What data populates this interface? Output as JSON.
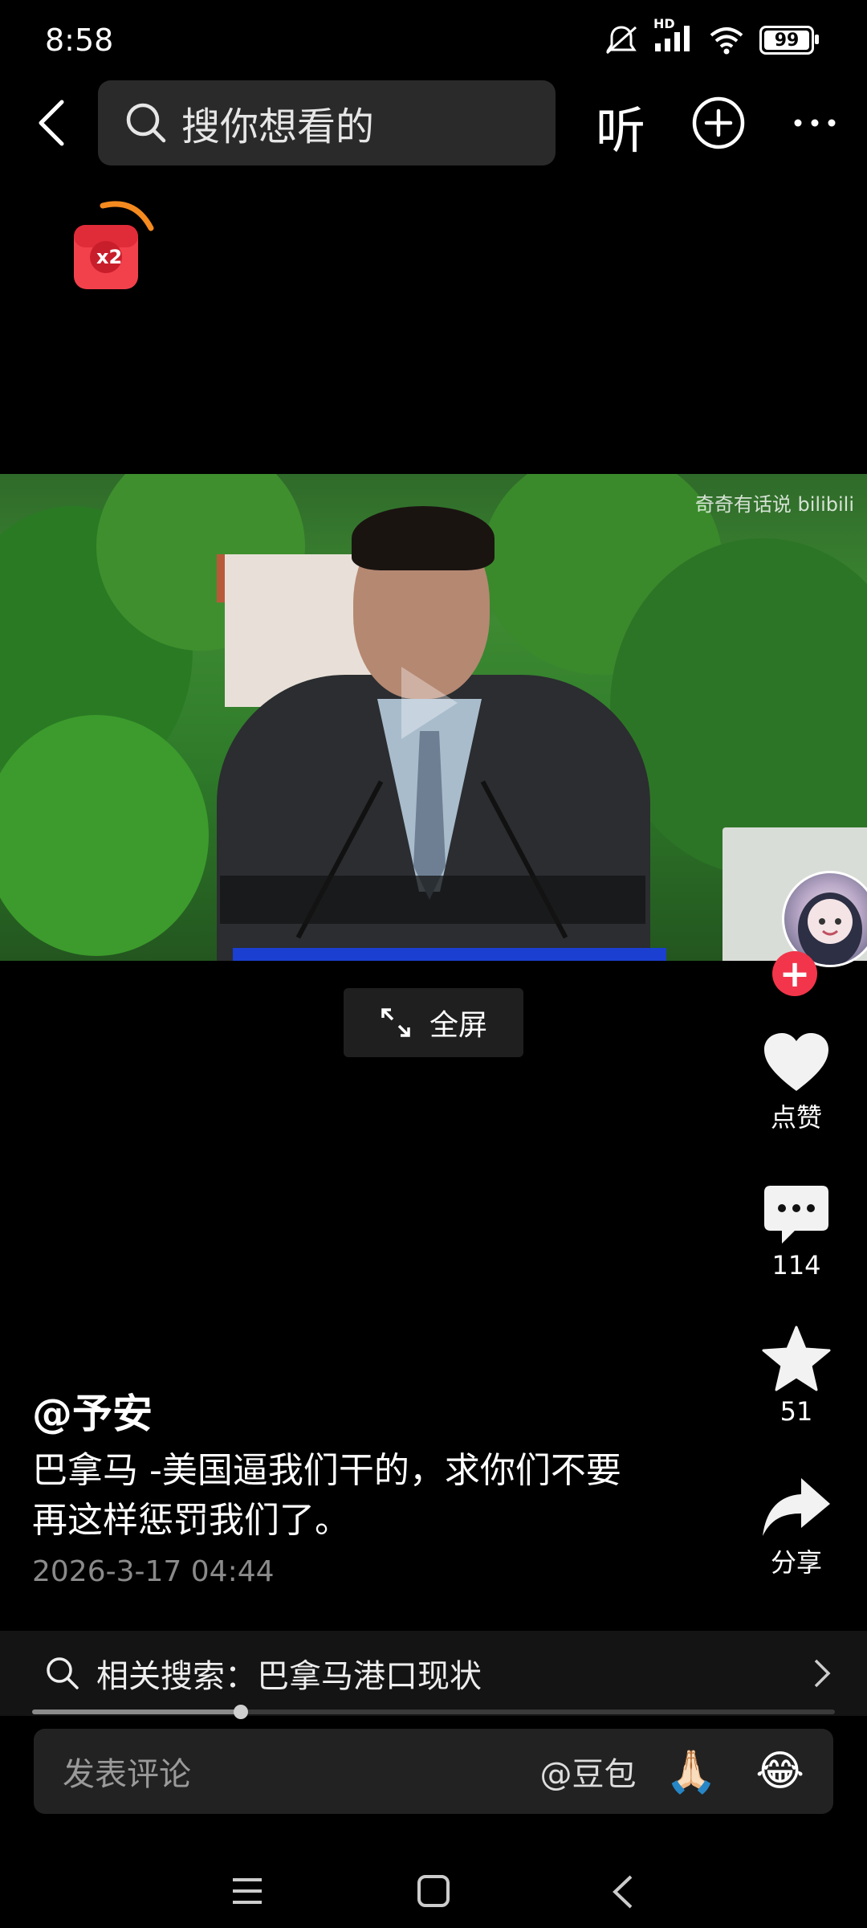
{
  "status": {
    "time": "8:58",
    "network": "HD",
    "battery": "99",
    "icons": [
      "mute-icon",
      "signal-icon",
      "wifi-icon",
      "battery-icon"
    ]
  },
  "topbar": {
    "search_placeholder": "搜你想看的",
    "listen_label": "听",
    "icons": [
      "back-icon",
      "search-icon",
      "add-icon",
      "more-icon"
    ]
  },
  "redpacket": {
    "multiplier": "x2"
  },
  "video": {
    "watermark": "奇奇有话说 bilibili",
    "fullscreen_label": "全屏"
  },
  "rail": {
    "like_label": "点赞",
    "comment_count": "114",
    "favorite_count": "51",
    "share_label": "分享"
  },
  "post": {
    "author": "@予安",
    "description_line1": "巴拿马 -美国逼我们干的，求你们不要",
    "description_line2": "再这样惩罚我们了。",
    "date": "2026-3-17 04:44"
  },
  "related": {
    "prefix": "相关搜索：",
    "query": "巴拿马港口现状"
  },
  "progress": {
    "played_fraction": 0.26
  },
  "comment_bar": {
    "placeholder": "发表评论",
    "mention": "@豆包",
    "emoji1": "🙏🏻",
    "emoji2": "😂"
  },
  "colors": {
    "accent_red": "#f2354a",
    "background": "#000000",
    "panel": "#222222"
  }
}
